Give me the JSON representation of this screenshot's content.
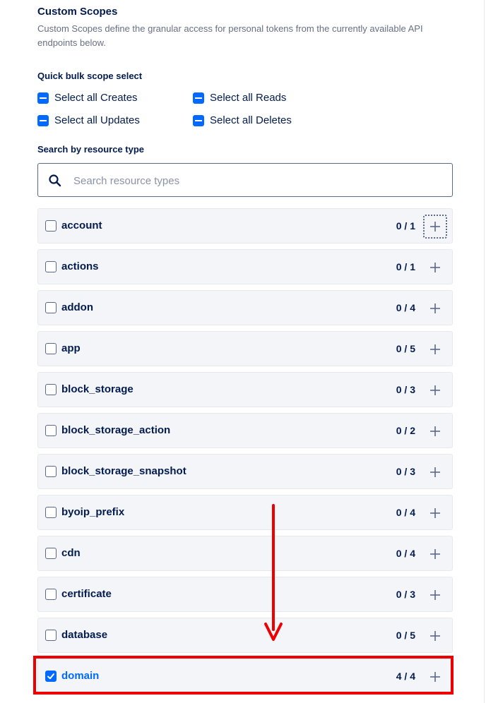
{
  "scopes": {
    "title": "Custom Scopes",
    "description": "Custom Scopes define the granular access for personal tokens from the currently available API endpoints below."
  },
  "bulk": {
    "label": "Quick bulk scope select",
    "creates": "Select all Creates",
    "reads": "Select all Reads",
    "updates": "Select all Updates",
    "deletes": "Select all Deletes"
  },
  "search": {
    "label": "Search by resource type",
    "placeholder": "Search resource types"
  },
  "resources": [
    {
      "name": "account",
      "count": "0 / 1",
      "checked": false
    },
    {
      "name": "actions",
      "count": "0 / 1",
      "checked": false
    },
    {
      "name": "addon",
      "count": "0 / 4",
      "checked": false
    },
    {
      "name": "app",
      "count": "0 / 5",
      "checked": false
    },
    {
      "name": "block_storage",
      "count": "0 / 3",
      "checked": false
    },
    {
      "name": "block_storage_action",
      "count": "0 / 2",
      "checked": false
    },
    {
      "name": "block_storage_snapshot",
      "count": "0 / 3",
      "checked": false
    },
    {
      "name": "byoip_prefix",
      "count": "0 / 4",
      "checked": false
    },
    {
      "name": "cdn",
      "count": "0 / 4",
      "checked": false
    },
    {
      "name": "certificate",
      "count": "0 / 3",
      "checked": false
    },
    {
      "name": "database",
      "count": "0 / 5",
      "checked": false
    },
    {
      "name": "domain",
      "count": "4 / 4",
      "checked": true
    }
  ],
  "colors": {
    "accent": "#0069ff",
    "annotation": "#ee0000",
    "text": "#031b4e",
    "row_bg": "#f3f5f9"
  },
  "icons": {
    "search": "search-icon",
    "expand": "plus-icon",
    "checked": "checkmark-icon",
    "bulk": "indeterminate-checkbox-icon"
  }
}
